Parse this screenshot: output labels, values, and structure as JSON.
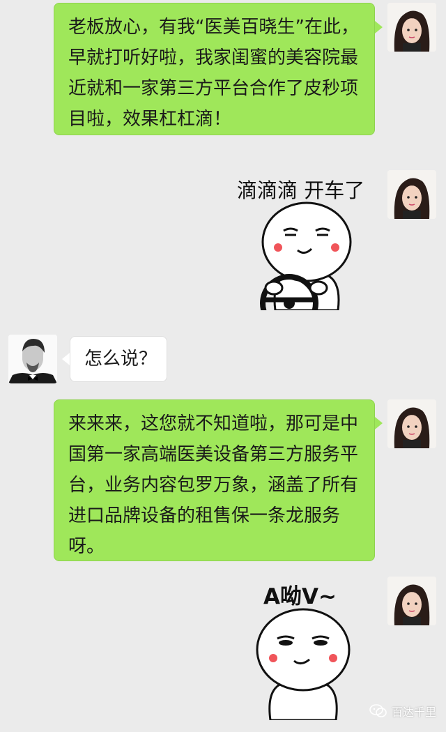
{
  "messages": [
    {
      "id": "m1",
      "from": "me",
      "type": "text",
      "text": "老板放心，有我“医美百晓生”在此，早就打听好啦，我家闺蜜的美容院最近就和一家第三方平台合作了皮秒项目啦，效果杠杠滴！"
    },
    {
      "id": "m2",
      "from": "me",
      "type": "sticker",
      "caption": "滴滴滴 开车了",
      "sticker": "driving-emoji-sticker"
    },
    {
      "id": "m3",
      "from": "other",
      "type": "text",
      "text": "怎么说？"
    },
    {
      "id": "m4",
      "from": "me",
      "type": "text",
      "text": "来来来，这您就不知道啦，那可是中国第一家高端医美设备第三方服务平台，业务内容包罗万象，涵盖了所有进口品牌设备的租售保一条龙服务呀。"
    },
    {
      "id": "m5",
      "from": "me",
      "type": "sticker",
      "caption": "A呦V~",
      "sticker": "smug-emoji-sticker"
    }
  ],
  "watermark": {
    "text": "百达千里",
    "icon": "wechat-official-account-icon"
  },
  "colors": {
    "background": "#ebebeb",
    "my_bubble": "#9fe75a",
    "other_bubble": "#ffffff",
    "blush": "#f0555a"
  }
}
